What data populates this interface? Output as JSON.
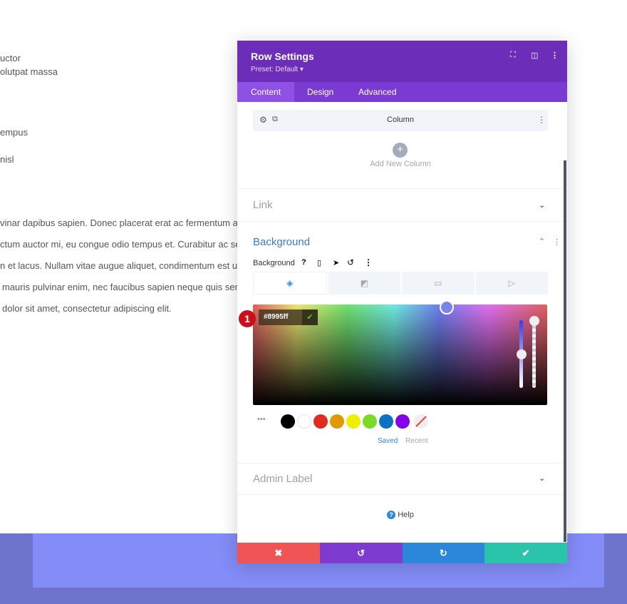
{
  "background_page": {
    "lines": [
      "uctor",
      "olutpat massa",
      "empus",
      "nisl",
      "vinar dapibus sapien. Donec placerat erat ac fermentum acc",
      "ctum auctor mi, eu congue odio tempus et. Curabitur ac sem",
      "n et lacus. Nullam vitae augue aliquet, condimentum est ut, v",
      "mauris pulvinar enim, nec faucibus sapien neque quis sem. T",
      "dolor sit amet, consectetur adipiscing elit."
    ]
  },
  "panel": {
    "title": "Row Settings",
    "preset": "Preset: Default ▾",
    "tabs": [
      {
        "label": "Content",
        "active": true
      },
      {
        "label": "Design"
      },
      {
        "label": "Advanced"
      }
    ],
    "column_label": "Column",
    "add_column": "Add New Column",
    "sections": {
      "link": "Link",
      "background": "Background",
      "admin_label": "Admin Label"
    },
    "background_label": "Background",
    "color_value": "#8995ff",
    "step_badge": "1",
    "swatches": [
      "#000000",
      "#ffffff",
      "#e02b20",
      "#e09900",
      "#edf000",
      "#7cda24",
      "#0c71c3",
      "#8300e9"
    ],
    "swatch_tabs": {
      "saved": "Saved",
      "recent": "Recent"
    },
    "help": "Help",
    "colors": {
      "header": "#6c2eb9",
      "tabs": "#7b3ad1",
      "cancel": "#ef5555",
      "undo": "#7e3bd0",
      "redo": "#2b87da",
      "save": "#29c4a9"
    }
  }
}
